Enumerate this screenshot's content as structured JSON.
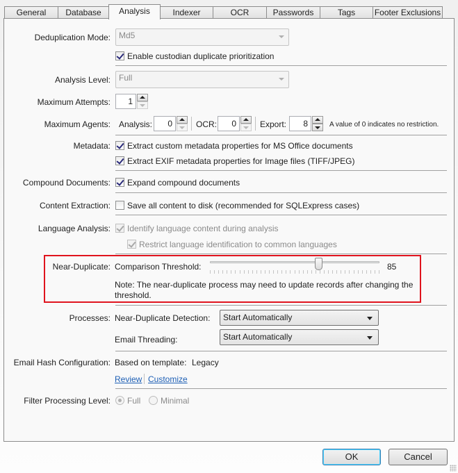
{
  "tabs": [
    {
      "label": "General",
      "active": false
    },
    {
      "label": "Database",
      "active": false
    },
    {
      "label": "Analysis",
      "active": true
    },
    {
      "label": "Indexer",
      "active": false
    },
    {
      "label": "OCR",
      "active": false
    },
    {
      "label": "Passwords",
      "active": false
    },
    {
      "label": "Tags",
      "active": false
    },
    {
      "label": "Footer Exclusions",
      "active": false
    }
  ],
  "dedup": {
    "label": "Deduplication Mode:",
    "value": "Md5",
    "custodian_checkbox": {
      "label": "Enable custodian duplicate prioritization",
      "checked": true
    }
  },
  "analysis_level": {
    "label": "Analysis Level:",
    "value": "Full"
  },
  "max_attempts": {
    "label": "Maximum Attempts:",
    "value": "1"
  },
  "max_agents": {
    "label": "Maximum Agents:",
    "analysis_label": "Analysis:",
    "analysis_value": "0",
    "ocr_label": "OCR:",
    "ocr_value": "0",
    "export_label": "Export:",
    "export_value": "8",
    "note": "A value of 0 indicates no restriction."
  },
  "metadata": {
    "label": "Metadata:",
    "office": {
      "label": "Extract custom metadata properties for MS Office documents",
      "checked": true
    },
    "exif": {
      "label": "Extract EXIF metadata properties for Image files (TIFF/JPEG)",
      "checked": true
    }
  },
  "compound": {
    "label": "Compound Documents:",
    "checkbox": {
      "label": "Expand compound documents",
      "checked": true
    }
  },
  "content_extraction": {
    "label": "Content Extraction:",
    "checkbox": {
      "label": "Save all content to disk (recommended for SQLExpress cases)",
      "checked": false
    }
  },
  "language": {
    "label": "Language Analysis:",
    "identify": {
      "label": "Identify language content during analysis",
      "checked": true,
      "disabled": true
    },
    "restrict": {
      "label": "Restrict language identification to common languages",
      "checked": true,
      "disabled": true
    }
  },
  "near_duplicate": {
    "label": "Near-Duplicate:",
    "threshold_label": "Comparison Threshold:",
    "threshold_value": "85",
    "slider_fraction": 0.64,
    "note": "Note: The near-duplicate process may need to update records after changing the threshold.",
    "highlight_color": "#e0141e"
  },
  "processes": {
    "label": "Processes:",
    "near_dup_label": "Near-Duplicate Detection:",
    "near_dup_value": "Start Automatically",
    "email_label": "Email Threading:",
    "email_value": "Start Automatically"
  },
  "email_hash": {
    "label": "Email Hash Configuration:",
    "based_on": "Based on template:",
    "template": "Legacy",
    "review_link": "Review",
    "customize_link": "Customize"
  },
  "filter_level": {
    "label": "Filter Processing Level:",
    "options": [
      {
        "label": "Full",
        "selected": true
      },
      {
        "label": "Minimal",
        "selected": false
      }
    ]
  },
  "buttons": {
    "ok": "OK",
    "cancel": "Cancel"
  }
}
